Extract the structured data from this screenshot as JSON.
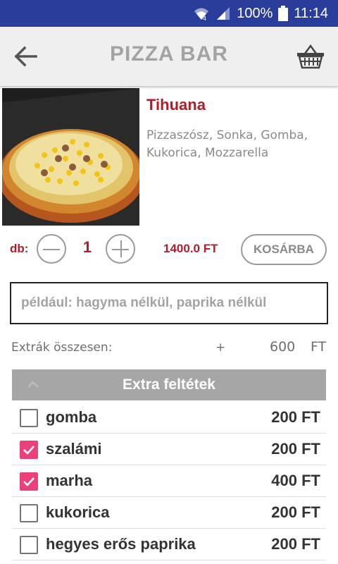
{
  "status_bar": {
    "battery": "100%",
    "time": "11:14",
    "icons": [
      "wifi-icon",
      "signal-icon",
      "battery-icon"
    ]
  },
  "app_bar": {
    "title": "PIZZA BAR",
    "back_icon": "arrow-left-icon",
    "cart_icon": "basket-icon"
  },
  "product": {
    "name": "Tihuana",
    "description": "Pizzaszósz, Sonka, Gomba, Kukorica, Mozzarella",
    "image": "pizza-photo"
  },
  "order": {
    "qty_label": "db:",
    "quantity": "1",
    "price": "1400.0 FT",
    "add_to_cart_label": "KOSÁRBA"
  },
  "note": {
    "placeholder": "például: hagyma nélkül, paprika nélkül",
    "value": ""
  },
  "extras_total": {
    "label": "Extrák összesen:",
    "sign": "+",
    "amount": "600",
    "currency": "FT"
  },
  "extras": {
    "header": "Extra feltétek",
    "items": [
      {
        "name": "gomba",
        "price": "200 FT",
        "checked": false
      },
      {
        "name": "szalámi",
        "price": "200 FT",
        "checked": true
      },
      {
        "name": "marha",
        "price": "400 FT",
        "checked": true
      },
      {
        "name": "kukorica",
        "price": "200 FT",
        "checked": false
      },
      {
        "name": "hegyes erős paprika",
        "price": "200 FT",
        "checked": false
      }
    ]
  },
  "colors": {
    "status_bar": "#2a3d9a",
    "accent_red": "#b31b2a",
    "checkbox_pink": "#ec407a",
    "header_gray": "#a6a6a6"
  }
}
